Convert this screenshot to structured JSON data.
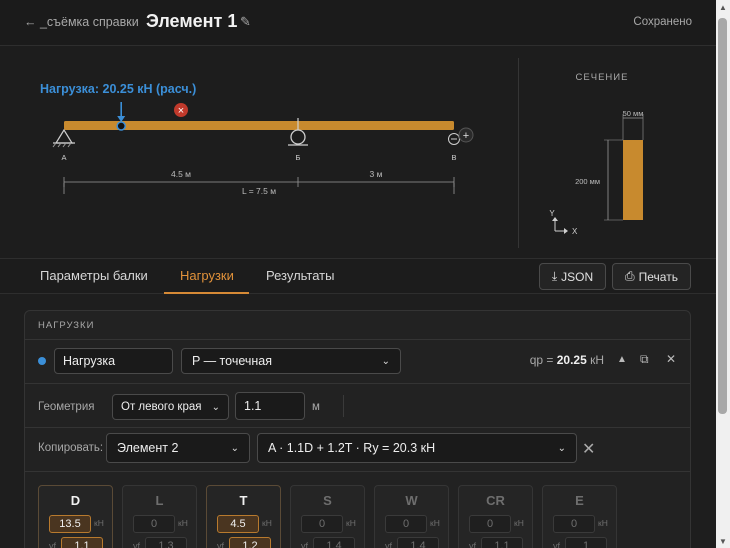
{
  "header": {
    "back_label": "← _съёмка справки",
    "title": "Элемент 1",
    "edit_icon": "pencil-icon",
    "status": "Сохранено"
  },
  "diagram": {
    "load_label": "Нагрузка: 20.25 кН (расч.)",
    "supports": [
      "А",
      "Б",
      "В"
    ],
    "spans": [
      "4.5 м",
      "3 м"
    ],
    "total_length": "L = 7.5 м",
    "zoom_out": "⊖",
    "zoom_in": "+",
    "remove_load": "×",
    "load_position_m": 1.1,
    "beam_length_m": 7.5,
    "colors": {
      "beam": "#c88a2e",
      "load": "#3b8fd8",
      "remove": "#c0392b"
    }
  },
  "section": {
    "title": "СЕЧЕНИЕ",
    "width_label": "50 мм",
    "height_label": "200 мм",
    "axis_y": "Y",
    "axis_x": "X"
  },
  "tabs": {
    "items": [
      "Параметры балки",
      "Нагрузки",
      "Результаты"
    ],
    "active_index": 1,
    "json_label": "JSON",
    "print_label": "Печать"
  },
  "loads": {
    "panel_title": "НАГРУЗКИ",
    "name_value": "Нагрузка",
    "type_value": "P — точечная",
    "qp_label": "qp = ",
    "qp_value": "20.25",
    "qp_unit": " кН",
    "geometry_label": "Геометрия",
    "geometry_ref": "От левого края",
    "geometry_value": "1.1",
    "geometry_unit": "м",
    "copy_label": "Копировать:",
    "copy_element": "Элемент 2",
    "combo_value": "A · 1.1D + 1.2T · Ry = 20.3 кН",
    "factors": [
      {
        "name": "D",
        "value": "13.5",
        "unit": "кН",
        "gf_label": "γf",
        "gf": "1.1",
        "active": true
      },
      {
        "name": "L",
        "value": "0",
        "unit": "кН",
        "gf_label": "γf",
        "gf": "1.3",
        "active": false
      },
      {
        "name": "T",
        "value": "4.5",
        "unit": "кН",
        "gf_label": "γf",
        "gf": "1.2",
        "active": true
      },
      {
        "name": "S",
        "value": "0",
        "unit": "кН",
        "gf_label": "γf",
        "gf": "1.4",
        "active": false
      },
      {
        "name": "W",
        "value": "0",
        "unit": "кН",
        "gf_label": "γf",
        "gf": "1.4",
        "active": false
      },
      {
        "name": "CR",
        "value": "0",
        "unit": "кН",
        "gf_label": "γf",
        "gf": "1.1",
        "active": false
      },
      {
        "name": "E",
        "value": "0",
        "unit": "кН",
        "gf_label": "γf",
        "gf": "1",
        "active": false
      }
    ]
  }
}
